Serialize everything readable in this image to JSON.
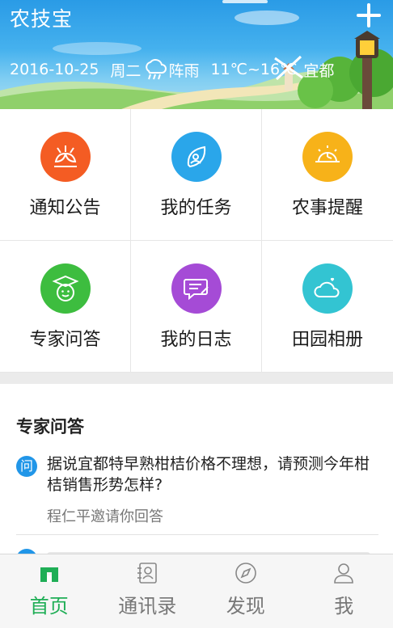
{
  "header": {
    "app_title": "农技宝",
    "weather": {
      "date": "2016-10-25",
      "weekday": "周二",
      "condition": "阵雨",
      "temperature": "11℃~16℃",
      "city": "宜都",
      "icon": "rain-cloud-icon"
    }
  },
  "grid": {
    "tiles": [
      {
        "label": "通知公告",
        "icon": "announcement-icon",
        "color": "#f45c23"
      },
      {
        "label": "我的任务",
        "icon": "task-leaf-icon",
        "color": "#2aa6ea"
      },
      {
        "label": "农事提醒",
        "icon": "sunrise-clock-icon",
        "color": "#f7b219"
      },
      {
        "label": "专家问答",
        "icon": "graduate-cap-icon",
        "color": "#3dbd3f"
      },
      {
        "label": "我的日志",
        "icon": "diary-chat-icon",
        "color": "#a54bd6"
      },
      {
        "label": "田园相册",
        "icon": "cloud-heart-icon",
        "color": "#33c4d2"
      }
    ]
  },
  "qa": {
    "section_title": "专家问答",
    "badge_text": "问",
    "question": "据说宜都特早熟柑桔价格不理想，请预测今年柑桔销售形势怎样?",
    "invite": "程仁平邀请你回答"
  },
  "tabbar": {
    "active_color": "#1fae56",
    "items": [
      {
        "label": "首页",
        "icon": "home-icon"
      },
      {
        "label": "通讯录",
        "icon": "contacts-icon"
      },
      {
        "label": "发现",
        "icon": "compass-icon"
      },
      {
        "label": "我",
        "icon": "profile-icon"
      }
    ]
  }
}
